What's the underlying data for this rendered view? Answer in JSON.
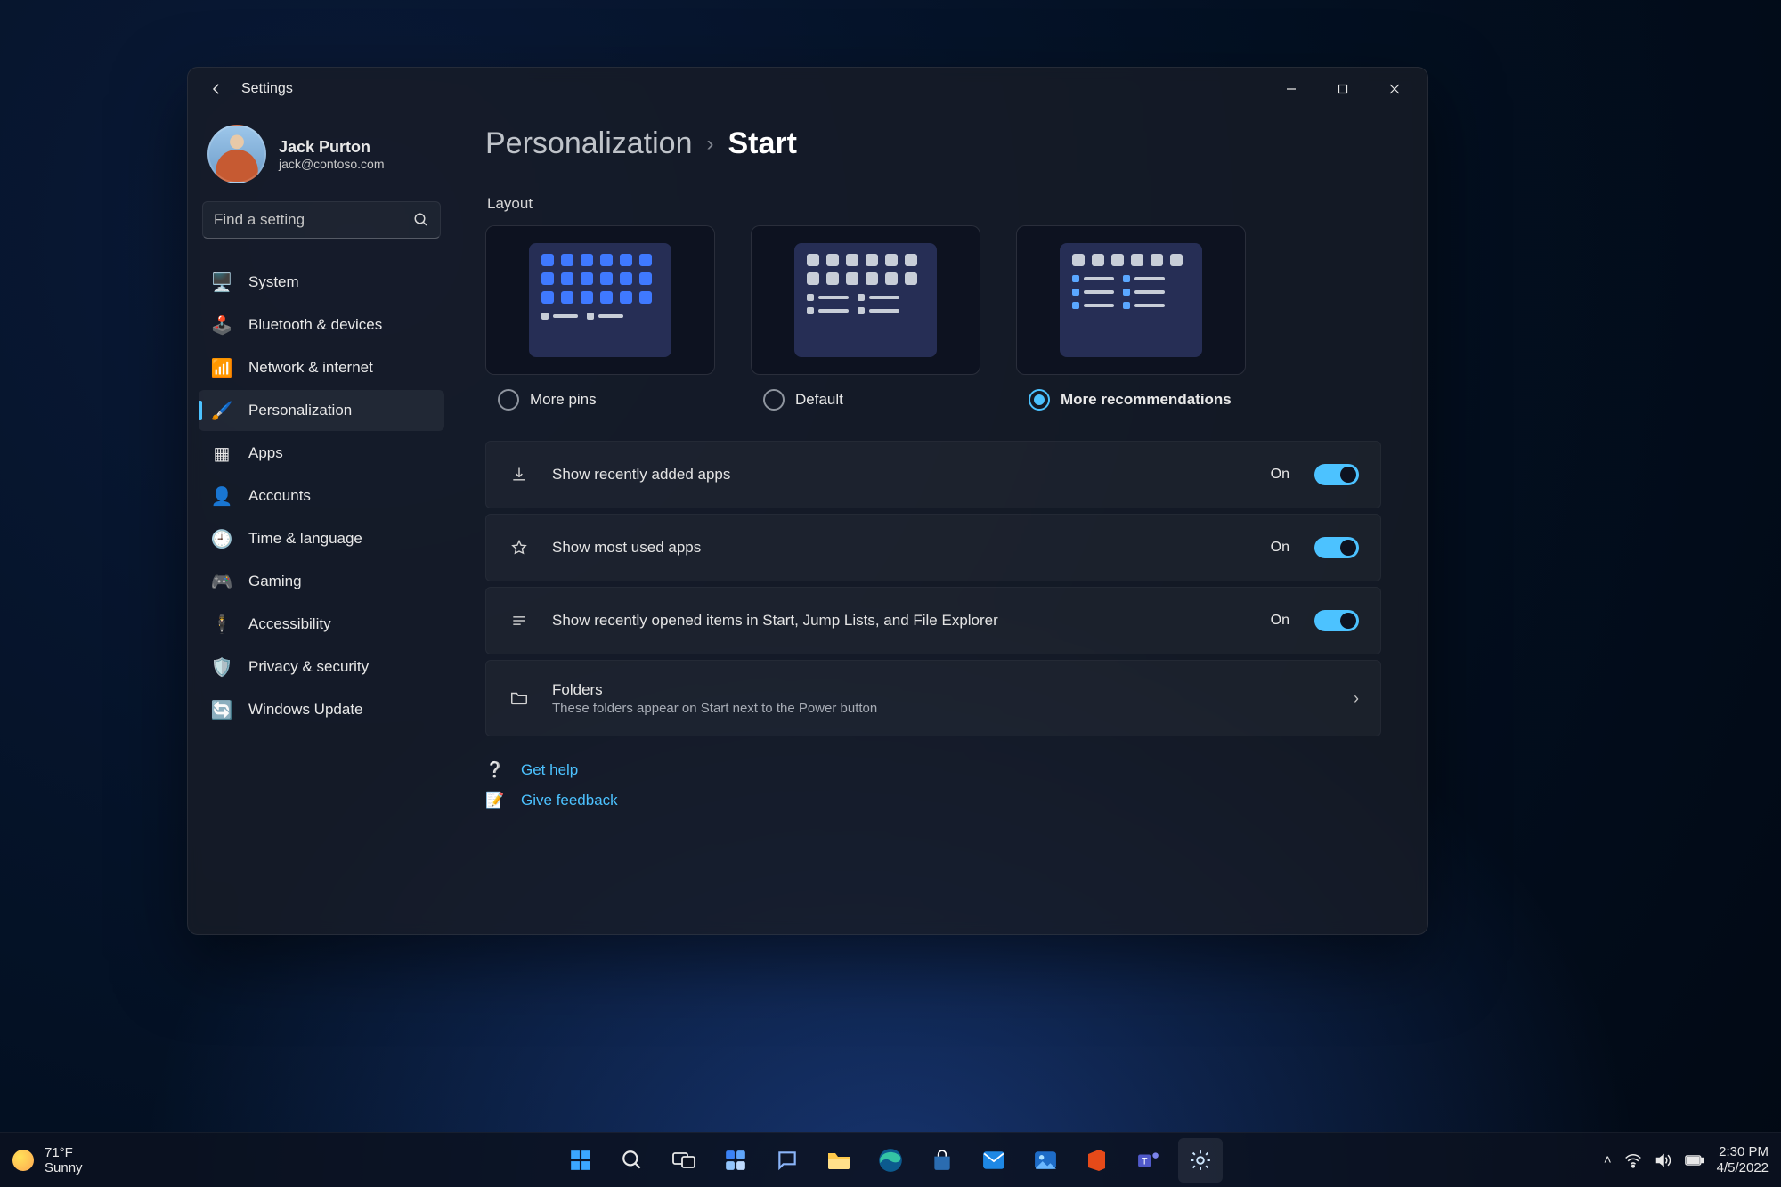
{
  "window": {
    "title": "Settings"
  },
  "profile": {
    "name": "Jack Purton",
    "email": "jack@contoso.com"
  },
  "search": {
    "placeholder": "Find a setting"
  },
  "sidebar": {
    "items": [
      {
        "label": "System",
        "icon": "🖥️",
        "active": false
      },
      {
        "label": "Bluetooth & devices",
        "icon": "🕹️",
        "active": false
      },
      {
        "label": "Network & internet",
        "icon": "📶",
        "active": false
      },
      {
        "label": "Personalization",
        "icon": "🖌️",
        "active": true
      },
      {
        "label": "Apps",
        "icon": "▦",
        "active": false
      },
      {
        "label": "Accounts",
        "icon": "👤",
        "active": false
      },
      {
        "label": "Time & language",
        "icon": "🕘",
        "active": false
      },
      {
        "label": "Gaming",
        "icon": "🎮",
        "active": false
      },
      {
        "label": "Accessibility",
        "icon": "🕴️",
        "active": false
      },
      {
        "label": "Privacy & security",
        "icon": "🛡️",
        "active": false
      },
      {
        "label": "Windows Update",
        "icon": "🔄",
        "active": false
      }
    ]
  },
  "breadcrumb": {
    "parent": "Personalization",
    "current": "Start"
  },
  "layout": {
    "section_label": "Layout",
    "options": [
      {
        "label": "More pins",
        "selected": false
      },
      {
        "label": "Default",
        "selected": false
      },
      {
        "label": "More recommendations",
        "selected": true
      }
    ]
  },
  "toggles": [
    {
      "label": "Show recently added apps",
      "state": "On",
      "icon": "download"
    },
    {
      "label": "Show most used apps",
      "state": "On",
      "icon": "star"
    },
    {
      "label": "Show recently opened items in Start, Jump Lists, and File Explorer",
      "state": "On",
      "icon": "list"
    }
  ],
  "folders_card": {
    "title": "Folders",
    "subtitle": "These folders appear on Start next to the Power button"
  },
  "help": {
    "get_help": "Get help",
    "give_feedback": "Give feedback"
  },
  "taskbar": {
    "weather_temp": "71°F",
    "weather_cond": "Sunny",
    "time": "2:30 PM",
    "date": "4/5/2022",
    "apps": [
      "start",
      "search",
      "task-view",
      "widgets",
      "chat",
      "file-explorer",
      "edge",
      "store",
      "mail",
      "photos",
      "office",
      "teams",
      "settings"
    ]
  },
  "colors": {
    "accent": "#4cc2ff"
  }
}
